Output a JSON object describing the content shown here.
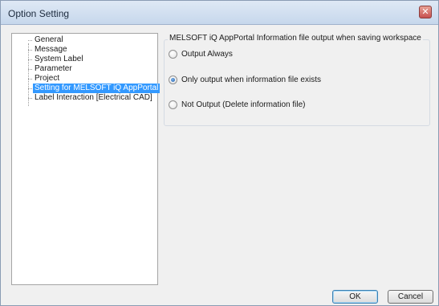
{
  "window": {
    "title": "Option Setting",
    "close_icon": "close-icon"
  },
  "tree": {
    "items": [
      {
        "label": "General",
        "selected": false
      },
      {
        "label": "Message",
        "selected": false
      },
      {
        "label": "System Label",
        "selected": false
      },
      {
        "label": "Parameter",
        "selected": false
      },
      {
        "label": "Project",
        "selected": false
      },
      {
        "label": "Setting for MELSOFT iQ AppPortal",
        "selected": true
      },
      {
        "label": "Label Interaction [Electrical CAD]",
        "selected": false
      }
    ]
  },
  "settings": {
    "group_title": "MELSOFT iQ AppPortal Information file output when saving workspace",
    "options": [
      {
        "label": "Output Always",
        "checked": false
      },
      {
        "label": "Only output when information file exists",
        "checked": true
      },
      {
        "label": "Not Output (Delete information file)",
        "checked": false
      }
    ]
  },
  "buttons": {
    "ok": "OK",
    "cancel": "Cancel"
  },
  "colors": {
    "selection": "#3399ff",
    "titlebar": "#c6d7ec",
    "close_button": "#c75050"
  }
}
